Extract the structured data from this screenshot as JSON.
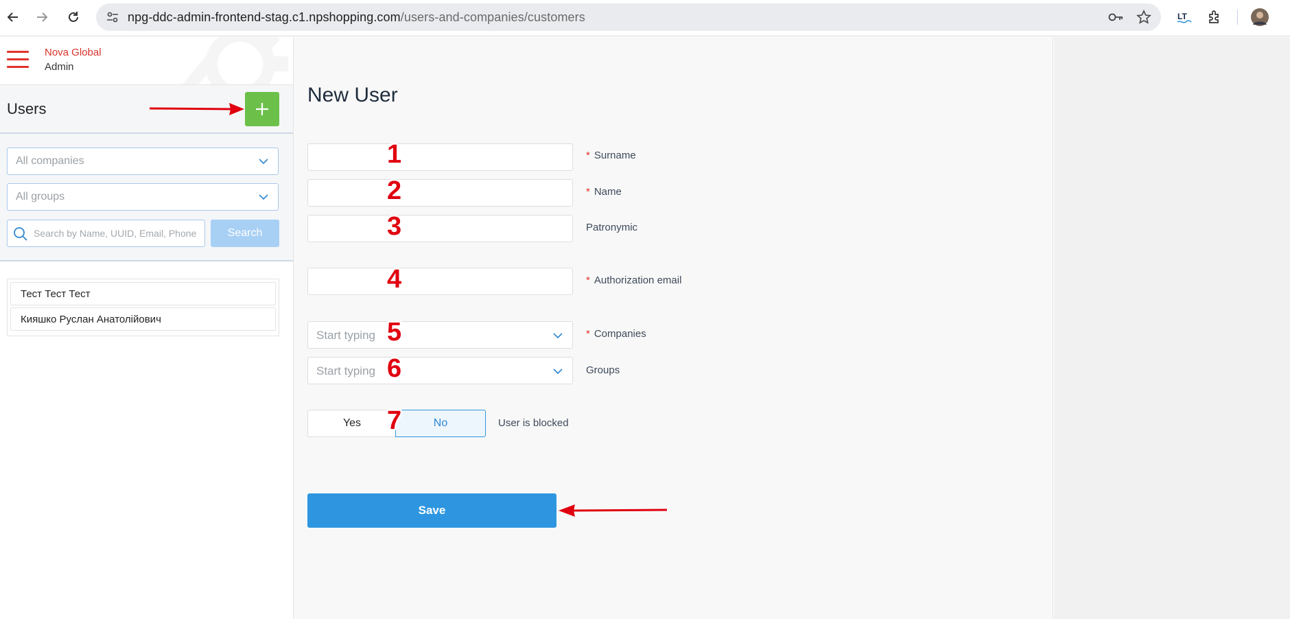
{
  "browser": {
    "url_domain": "npg-ddc-admin-frontend-stag.c1.npshopping.com",
    "url_path": "/users-and-companies/customers"
  },
  "sidebar": {
    "brand_line1": "Nova Global",
    "brand_line2": "Admin",
    "title": "Users",
    "company_filter": "All companies",
    "group_filter": "All groups",
    "search_placeholder": "Search by Name, UUID, Email, Phone",
    "search_button": "Search",
    "users": [
      "Тест Тест Тест",
      "Кияшко Руслан Анатолійович"
    ]
  },
  "form": {
    "title": "New User",
    "surname_label": "Surname",
    "name_label": "Name",
    "patronymic_label": "Patronymic",
    "email_label": "Authorization email",
    "companies_placeholder": "Start typing",
    "companies_label": "Companies",
    "groups_placeholder": "Start typing",
    "groups_label": "Groups",
    "blocked_yes": "Yes",
    "blocked_no": "No",
    "blocked_selected": "No",
    "blocked_label": "User is blocked",
    "save_label": "Save",
    "required_mark": "*"
  },
  "annotations": {
    "numbers": [
      "1",
      "2",
      "3",
      "4",
      "5",
      "6",
      "7"
    ],
    "color": "#e0000f"
  },
  "colors": {
    "brand_red": "#e0322b",
    "add_green": "#6cc04a",
    "primary_blue": "#2e96e0"
  }
}
